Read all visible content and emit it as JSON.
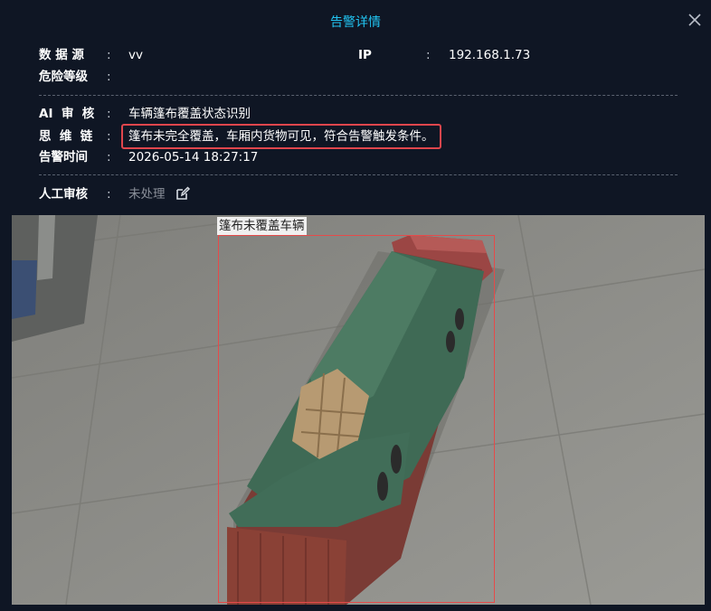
{
  "dialog": {
    "title": "告警详情"
  },
  "info": {
    "data_source_label": "数 据 源",
    "data_source_value": "vv",
    "ip_label": "IP",
    "ip_value": "192.168.1.73",
    "danger_level_label": "危险等级",
    "danger_level_value": "",
    "ai_review_label": "AI  审  核",
    "ai_review_value": "车辆篷布覆盖状态识别",
    "chain_label": "思  维  链",
    "chain_value": "篷布未完全覆盖，车厢内货物可见，符合告警触发条件。",
    "alarm_time_label": "告警时间",
    "alarm_time_value": "2026-05-14 18:27:17",
    "manual_review_label": "人工审核",
    "manual_review_value": "未处理",
    "colon": ":"
  },
  "image": {
    "detection_label": "篷布未覆盖车辆"
  },
  "colors": {
    "title": "#21c4f2",
    "highlight_border": "#e0464d",
    "bbox": "#e64a4a"
  },
  "icons": [
    "close-icon",
    "edit-icon"
  ]
}
